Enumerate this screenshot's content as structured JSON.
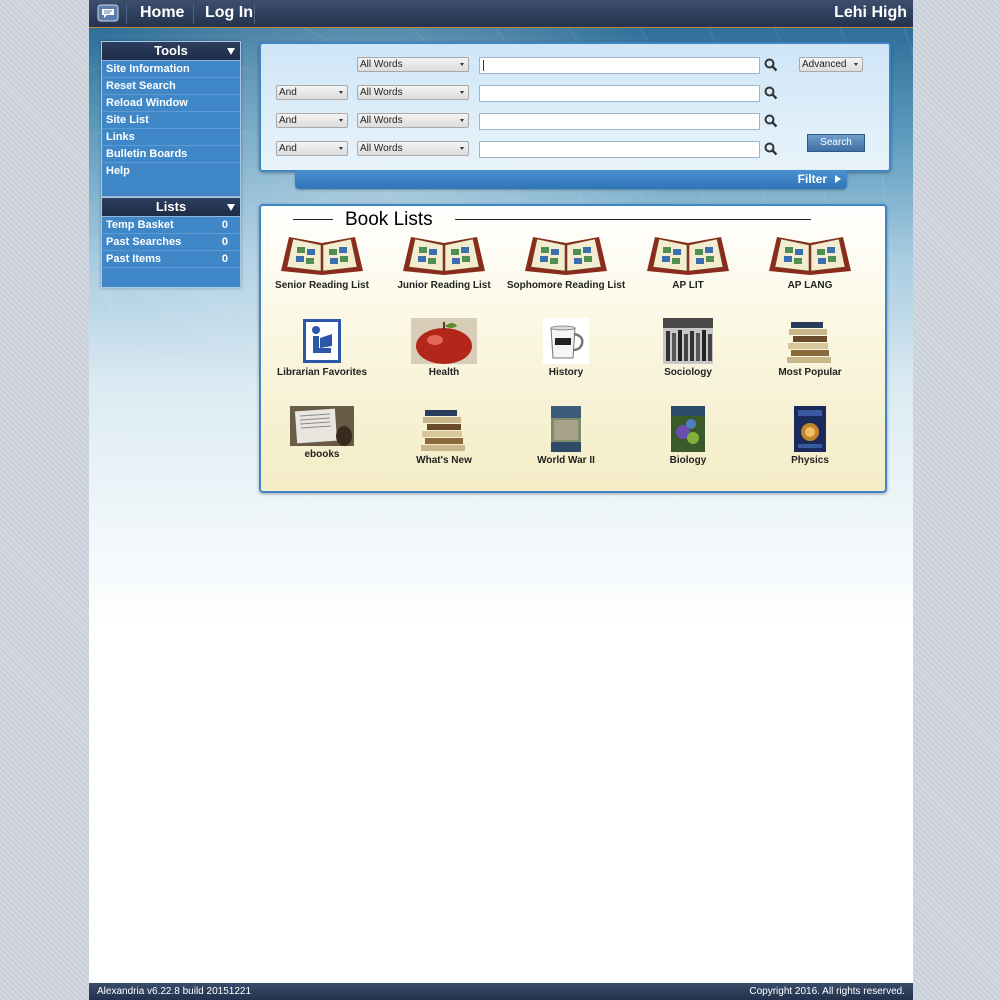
{
  "topbar": {
    "home": "Home",
    "login": "Log In",
    "site_name": "Lehi High",
    "logo_icon": "chat-bubble-icon"
  },
  "tools": {
    "title": "Tools",
    "items": [
      {
        "label": "Site Information"
      },
      {
        "label": "Reset Search"
      },
      {
        "label": "Reload Window"
      },
      {
        "label": "Site List"
      },
      {
        "label": "Links"
      },
      {
        "label": "Bulletin Boards"
      },
      {
        "label": "Help"
      }
    ]
  },
  "lists": {
    "title": "Lists",
    "items": [
      {
        "label": "Temp Basket",
        "count": "0"
      },
      {
        "label": "Past Searches",
        "count": "0"
      },
      {
        "label": "Past Items",
        "count": "0"
      }
    ]
  },
  "search": {
    "rows": [
      {
        "field": "All Words",
        "value": ""
      },
      {
        "operator": "And",
        "field": "All Words",
        "value": ""
      },
      {
        "operator": "And",
        "field": "All Words",
        "value": ""
      },
      {
        "operator": "And",
        "field": "All Words",
        "value": ""
      }
    ],
    "mode": "Advanced",
    "button": "Search",
    "filter": "Filter",
    "icon": "magnifier-icon"
  },
  "book_lists": {
    "title": "Book Lists",
    "items": [
      {
        "label": "Senior Reading List",
        "icon": "open-book-icon"
      },
      {
        "label": "Junior Reading List",
        "icon": "open-book-icon"
      },
      {
        "label": "Sophomore Reading List",
        "icon": "open-book-icon"
      },
      {
        "label": "AP LIT",
        "icon": "open-book-icon"
      },
      {
        "label": "AP LANG",
        "icon": "open-book-icon"
      },
      {
        "label": "Librarian Favorites",
        "icon": "library-reader-icon"
      },
      {
        "label": "Health",
        "icon": "apple-icon"
      },
      {
        "label": "History",
        "icon": "mug-icon"
      },
      {
        "label": "Sociology",
        "icon": "sociology-cover-icon"
      },
      {
        "label": "Most Popular",
        "icon": "book-stack-icon"
      },
      {
        "label": "ebooks",
        "icon": "ereader-icon"
      },
      {
        "label": "What's New",
        "icon": "book-stack-icon"
      },
      {
        "label": "World War II",
        "icon": "ww2-cover-icon"
      },
      {
        "label": "Biology",
        "icon": "biology-cover-icon"
      },
      {
        "label": "Physics",
        "icon": "physics-cover-icon"
      }
    ]
  },
  "footer": {
    "version": "Alexandria v6.22.8 build 20151221",
    "copyright": "Copyright 2016. All rights reserved."
  }
}
